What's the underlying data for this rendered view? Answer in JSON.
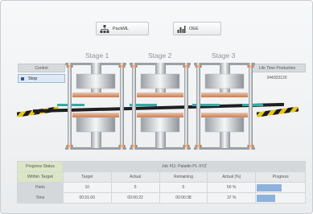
{
  "toolbar": {
    "packml_label": "PackML",
    "oee_label": "OEE",
    "packml_icon": "hierarchy-icon",
    "oee_icon": "bar-chart-icon"
  },
  "stages": [
    "Stage 1",
    "Stage 2",
    "Stage 3"
  ],
  "control": {
    "header": "Control",
    "stop_label": "Stop"
  },
  "life_time": {
    "header": "Life Time Production",
    "value": "344303120"
  },
  "progress": {
    "status_label": "Progress Status",
    "within_target_label": "Within Target",
    "job_title": "Job #11: Paladin PL-XYZ",
    "columns": [
      "Target",
      "Actual",
      "Remaining",
      "Actual (%)",
      "Progress"
    ],
    "rows": [
      {
        "label": "Parts",
        "target": "10",
        "actual": "5",
        "remaining": "5",
        "actual_pct": "50 %",
        "progress": 0.5
      },
      {
        "label": "Time",
        "target": "00:01:00",
        "actual": "00:00:22",
        "remaining": "00:00:38",
        "actual_pct": "37 %",
        "progress": 0.37
      }
    ]
  },
  "colors": {
    "accent": "#2c5aa0",
    "progress_fill": "#8eb2dd",
    "status_green": "#dbe6c6",
    "conveyor_teal": "#3aa7a3",
    "copper": "#d79a74"
  }
}
